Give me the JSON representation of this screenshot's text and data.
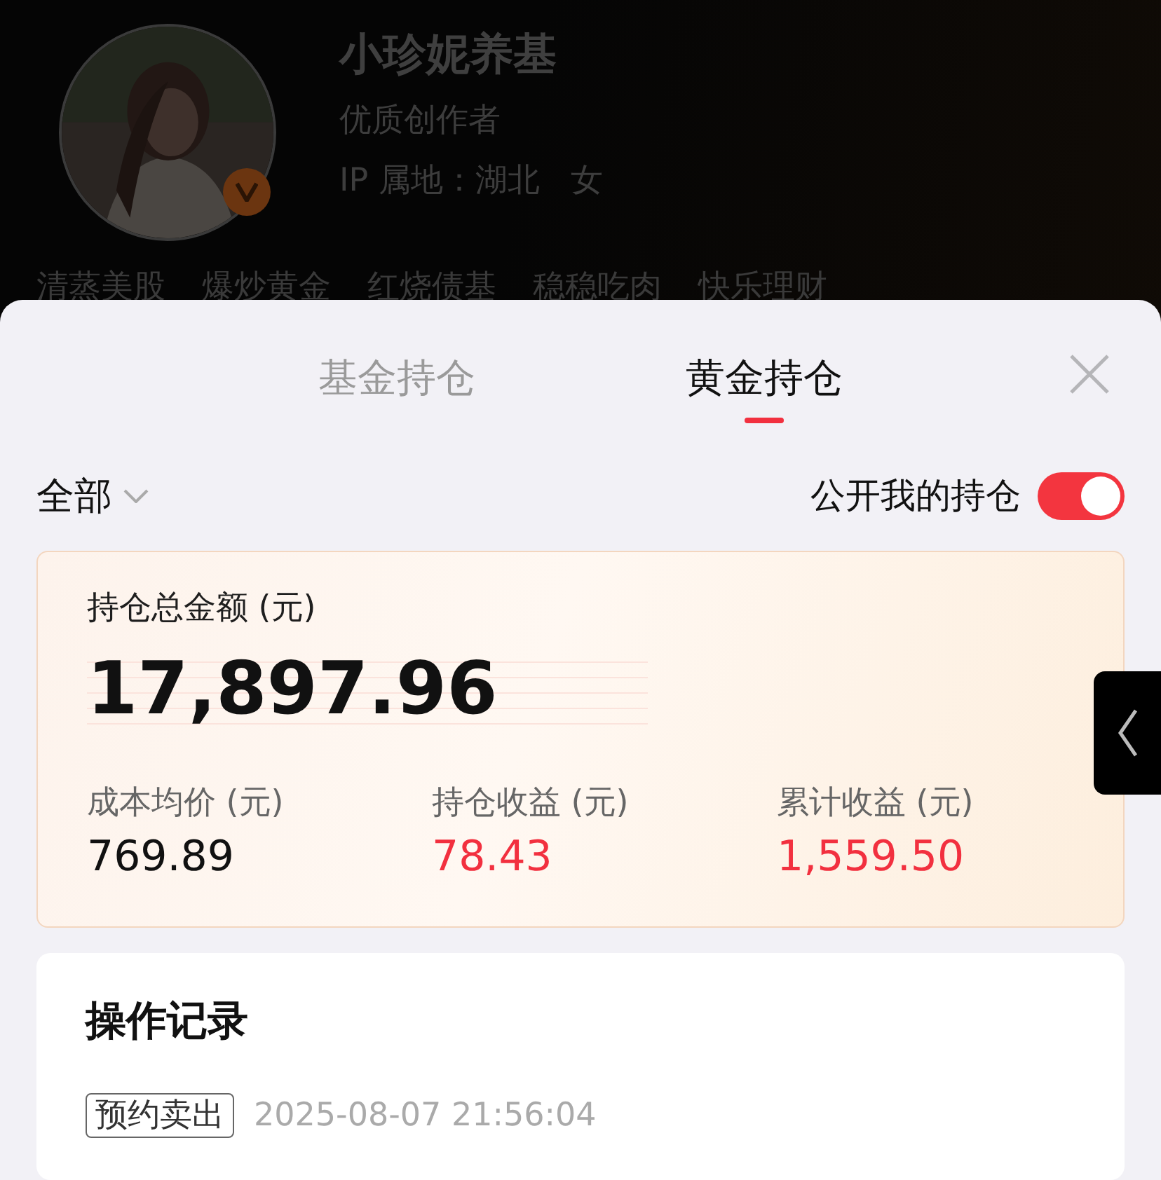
{
  "profile": {
    "name": "小珍妮养基",
    "title": "优质创作者",
    "location": "IP 属地：湖北",
    "gender": "女",
    "tags": [
      "清蒸美股",
      "爆炒黄金",
      "红烧债基",
      "稳稳吃肉",
      "快乐理财"
    ]
  },
  "sheet": {
    "tabs": [
      {
        "label": "基金持仓",
        "selected": false
      },
      {
        "label": "黄金持仓",
        "selected": true
      }
    ],
    "filter": {
      "label": "全部"
    },
    "public_toggle": {
      "label": "公开我的持仓",
      "on": true
    },
    "summary": {
      "total_label": "持仓总金额 (元)",
      "total": "17,897.96",
      "stats": [
        {
          "label": "成本均价 (元)",
          "value": "769.89",
          "kind": "neutral"
        },
        {
          "label": "持仓收益 (元)",
          "value": "78.43",
          "kind": "gain"
        },
        {
          "label": "累计收益 (元)",
          "value": "1,559.50",
          "kind": "gain"
        }
      ]
    },
    "records": {
      "title": "操作记录",
      "items": [
        {
          "tag": "预约卖出",
          "time": "2025-08-07 21:56:04"
        }
      ]
    }
  }
}
